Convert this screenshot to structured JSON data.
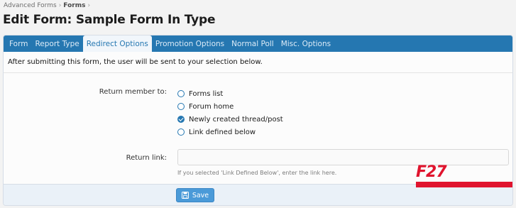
{
  "breadcrumb": {
    "items": [
      "Advanced Forms",
      "Forms"
    ]
  },
  "page": {
    "title": "Edit Form: Sample Form In Type"
  },
  "tabs": [
    {
      "label": "Form"
    },
    {
      "label": "Report Type"
    },
    {
      "label": "Redirect Options",
      "active": true
    },
    {
      "label": "Promotion Options"
    },
    {
      "label": "Normal Poll"
    },
    {
      "label": "Misc. Options"
    }
  ],
  "intro_text": "After submitting this form, the user will be sent to your selection below.",
  "return_member": {
    "label": "Return member to:",
    "options": [
      {
        "label": "Forms list",
        "checked": false
      },
      {
        "label": "Forum home",
        "checked": false
      },
      {
        "label": "Newly created thread/post",
        "checked": true
      },
      {
        "label": "Link defined below",
        "checked": false
      }
    ]
  },
  "return_link": {
    "label": "Return link:",
    "value": "",
    "hint": "If you selected 'Link Defined Below', enter the link here."
  },
  "save_button": {
    "label": "Save",
    "icon": "floppy-disk-icon"
  },
  "watermark": {
    "text": "F27"
  },
  "colors": {
    "accent": "#2577b1",
    "button": "#4a9ad8",
    "watermark": "#e0142e"
  }
}
